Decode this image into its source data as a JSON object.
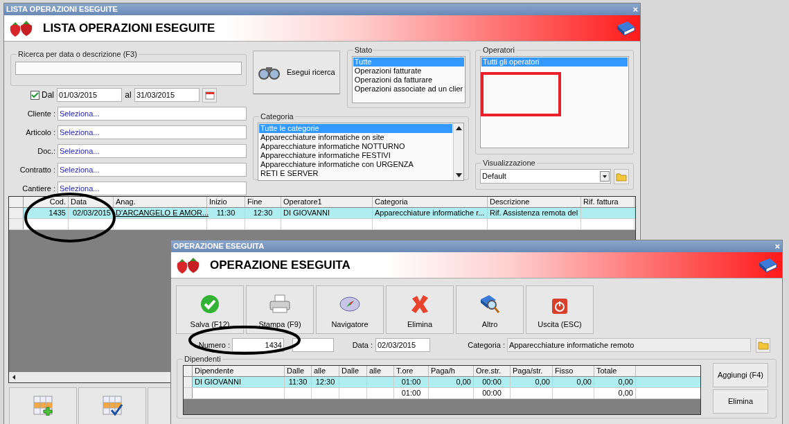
{
  "list_window": {
    "title": "LISTA OPERAZIONI ESEGUITE",
    "close": "×",
    "header": "LISTA OPERAZIONI ESEGUITE",
    "search": {
      "label": "Ricerca per data o descrizione (F3)"
    },
    "date_filter": {
      "checked": true,
      "label": "Dal",
      "from": "01/03/2015",
      "to_label": "al",
      "to": "31/03/2015"
    },
    "filters": [
      {
        "label": "Cliente :",
        "value": "Seleziona..."
      },
      {
        "label": "Articolo :",
        "value": "Seleziona..."
      },
      {
        "label": "Doc.:",
        "value": "Seleziona..."
      },
      {
        "label": "Contratto :",
        "value": "Seleziona..."
      },
      {
        "label": "Cantiere :",
        "value": "Seleziona..."
      }
    ],
    "search_button": "Esegui ricerca",
    "stato": {
      "label": "Stato",
      "items": [
        {
          "label": "Tutte",
          "selected": true
        },
        {
          "label": "Operazioni fatturate",
          "selected": false
        },
        {
          "label": "Operazioni da fatturare",
          "selected": false
        },
        {
          "label": "Operazioni associate ad un clier",
          "selected": false
        }
      ]
    },
    "categoria": {
      "label": "Categoria",
      "items": [
        {
          "label": "Tutte le categorie",
          "selected": true
        },
        {
          "label": "Apparecchiature informatiche on site",
          "selected": false
        },
        {
          "label": "Apparecchiature informatiche NOTTURNO",
          "selected": false
        },
        {
          "label": "Apparecchiature informatiche FESTIVI",
          "selected": false
        },
        {
          "label": "Apparecchiature informatiche con URGENZA",
          "selected": false
        },
        {
          "label": "RETI E SERVER",
          "selected": false
        }
      ]
    },
    "operatori": {
      "label": "Operatori",
      "items": [
        {
          "label": "Tutti gli operatori",
          "selected": true
        }
      ]
    },
    "visualizzazione": {
      "label": "Visualizzazione",
      "value": "Default"
    },
    "table": {
      "columns": [
        "Cod.",
        "Data",
        "Anag.",
        "Inizio",
        "Fine",
        "Operatore1",
        "Categoria",
        "Descrizione",
        "Rif. fattura"
      ],
      "rows": [
        {
          "selected": true,
          "cells": [
            "1435",
            "02/03/2015",
            "D'ARCANGELO E AMOR...",
            "11:30",
            "12:30",
            "DI GIOVANNI",
            "Apparecchiature informatiche r...",
            "Rif. Assistenza remota del",
            null
          ]
        },
        {
          "selected": false,
          "cells": [
            null,
            null,
            null,
            null,
            null,
            null,
            null,
            null,
            null
          ]
        }
      ]
    },
    "bottom_buttons": [
      {
        "kind": "add"
      },
      {
        "kind": "confirm"
      },
      {
        "kind": "blank"
      }
    ]
  },
  "detail_window": {
    "title": "OPERAZIONE ESEGUITA",
    "close": "×",
    "header": "OPERAZIONE ESEGUITA",
    "toolbar": [
      {
        "kind": "save",
        "label": "Salva (F12)"
      },
      {
        "kind": "print",
        "label": "Stampa (F9)"
      },
      {
        "kind": "navigator",
        "label": "Navigatore"
      },
      {
        "kind": "delete",
        "label": "Elimina"
      },
      {
        "kind": "other",
        "label": "Altro"
      },
      {
        "kind": "exit",
        "label": "Uscita (ESC)"
      }
    ],
    "numero": {
      "label": "Numero :",
      "value": "1434"
    },
    "data": {
      "label": "Data :",
      "value": "02/03/2015"
    },
    "categoria": {
      "label": "Categoria :",
      "value": "Apparecchiature informatiche remoto"
    },
    "dipendenti": {
      "label": "Dipendenti",
      "columns": [
        "Dipendente",
        "Dalle",
        "alle",
        "Dalle",
        "alle",
        "T.ore",
        "Paga/h",
        "Ore.str.",
        "Paga/str.",
        "Fisso",
        "Totale"
      ],
      "rows": [
        {
          "selected": true,
          "cells": [
            "DI GIOVANNI",
            "11:30",
            "12:30",
            null,
            null,
            "01:00",
            "0,00",
            "00:00",
            "0,00",
            "0,00",
            "0,00"
          ]
        },
        {
          "selected": false,
          "cells": [
            null,
            null,
            null,
            null,
            null,
            "01:00",
            null,
            "00:00",
            null,
            null,
            "0,00"
          ]
        }
      ],
      "buttons": [
        "Aggiungi (F4)",
        "Elimina"
      ]
    }
  }
}
